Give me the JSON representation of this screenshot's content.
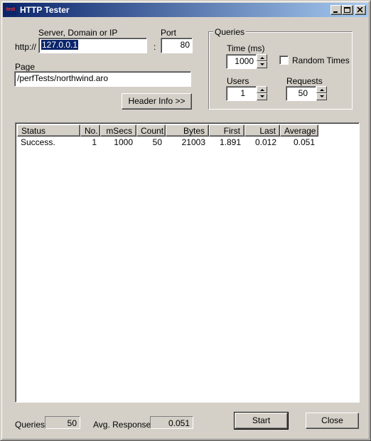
{
  "window": {
    "icon_text": "test",
    "title": "HTTP Tester"
  },
  "server": {
    "label": "Server, Domain or IP",
    "prefix": "http://",
    "value": "127.0.0.1",
    "separator": ":"
  },
  "port": {
    "label": "Port",
    "value": "80"
  },
  "page": {
    "label": "Page",
    "value": "/perfTests/northwind.aro"
  },
  "header_info_button": "Header Info  >>",
  "queries_group": {
    "legend": "Queries",
    "time_label": "Time  (ms)",
    "time_value": "1000",
    "random_times_label": "Random Times",
    "random_times_checked": false,
    "users_label": "Users",
    "users_value": "1",
    "requests_label": "Requests",
    "requests_value": "50"
  },
  "results": {
    "columns": [
      "Status",
      "No.",
      "mSecs",
      "Count",
      "Bytes",
      "First",
      "Last",
      "Average"
    ],
    "rows": [
      {
        "status": "Success.",
        "no": "1",
        "msecs": "1000",
        "count": "50",
        "bytes": "21003",
        "first": "1.891",
        "last": "0.012",
        "average": "0.051"
      }
    ]
  },
  "footer": {
    "queries_label": "Queries",
    "queries_value": "50",
    "avg_response_label": "Avg. Response",
    "avg_response_value": "0.051",
    "start_button": "Start",
    "close_button": "Close"
  }
}
